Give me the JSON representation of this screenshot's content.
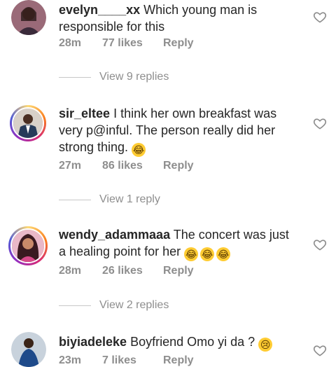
{
  "comments": [
    {
      "username": "evelyn____xx",
      "text": " Which young man is responsible for this",
      "time": "28m",
      "likes": "77 likes",
      "reply_label": "Reply",
      "view_replies": "View 9 replies"
    },
    {
      "username": "sir_eltee",
      "text": " I think her own breakfast was very p@inful. The person really did her strong thing. ",
      "time": "27m",
      "likes": "86 likes",
      "reply_label": "Reply",
      "view_replies": "View 1 reply"
    },
    {
      "username": "wendy_adammaaa",
      "text": " The concert was just a healing point for her ",
      "time": "28m",
      "likes": "26 likes",
      "reply_label": "Reply",
      "view_replies": "View 2 replies"
    },
    {
      "username": "biyiadeleke",
      "text": " Boyfriend Omo yi da ? ",
      "time": "23m",
      "likes": "7 likes",
      "reply_label": "Reply"
    }
  ],
  "emoji": {
    "laugh": "😂",
    "sad": "😢"
  },
  "colors": {
    "meta": "#8e8e8e",
    "story_ring": "#d62976"
  }
}
